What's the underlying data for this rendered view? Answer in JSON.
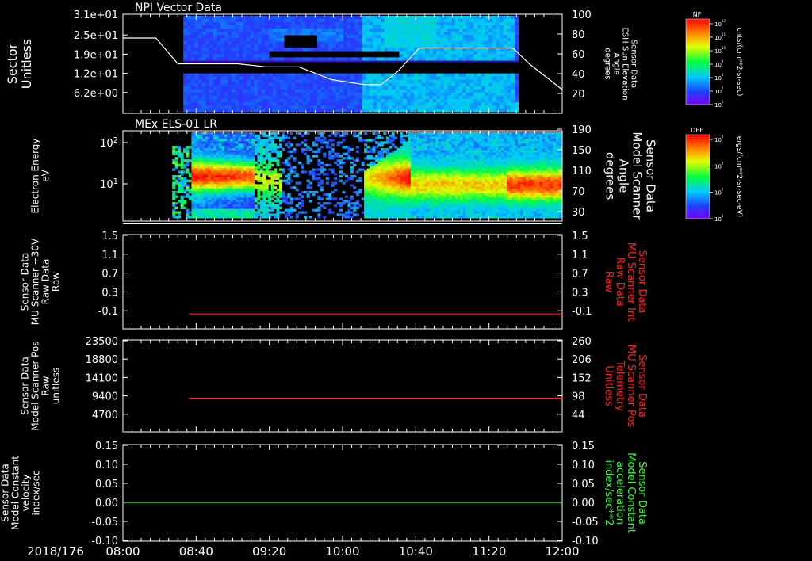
{
  "date_label": "2018/176",
  "time_ticks": [
    "08:00",
    "08:40",
    "09:20",
    "10:00",
    "10:40",
    "11:20",
    "12:00"
  ],
  "colors": {
    "white": "#ffffff",
    "red": "#ff2020",
    "green": "#33ff33",
    "background": "#000000"
  },
  "colorbars": [
    {
      "title": "NF",
      "unit": "cnts/(cm**2-sr-sec)",
      "ticks": [
        "10^12",
        "10^11",
        "10^10",
        "10^9",
        "10^8",
        "10^7",
        "10^6"
      ]
    },
    {
      "title": "DEF",
      "unit": "ergs/(cm**2-sr-sec-eV)",
      "ticks": [
        "10^4",
        "10^3",
        "10^2",
        "10^1"
      ]
    }
  ],
  "chart_data": [
    {
      "type": "heatmap",
      "title": "NPI Vector Data",
      "ylabel_lines": [
        "Sector",
        "Unitless"
      ],
      "yticks": [
        "3.1e+01",
        "2.5e+01",
        "1.9e+01",
        "1.2e+01",
        "6.2e+00"
      ],
      "right_label_lines": [
        "Sensor Data",
        "ESH Sun Elevation",
        "Angle",
        "degrees"
      ],
      "right_ticks": [
        "100",
        "80",
        "60",
        "40",
        "20"
      ],
      "right_ylim": [
        0,
        100
      ],
      "overlay_series": {
        "name": "ESH Sun Elevation Angle",
        "x_hours": [
          8.0,
          8.3,
          8.5,
          8.8,
          9.05,
          9.3,
          9.6,
          9.9,
          10.2,
          10.35,
          10.5,
          10.7,
          10.9,
          11.0,
          11.2,
          11.4,
          11.55,
          11.7,
          12.0
        ],
        "y": [
          76,
          76,
          50,
          50,
          50,
          47,
          47,
          34,
          29,
          29,
          42,
          66,
          66,
          66,
          66,
          66,
          66,
          50,
          24
        ]
      }
    },
    {
      "type": "heatmap",
      "title": "MEx ELS-01 LR",
      "ylabel_lines": [
        "Electron Energy",
        "eV"
      ],
      "yticks": [
        "10^2",
        "10^1"
      ],
      "right_label_lines": [
        "Sensor Data",
        "Model Scanner",
        "Angle",
        "degrees"
      ],
      "right_ticks": [
        "190",
        "150",
        "110",
        "70",
        "30"
      ],
      "right_ylim": [
        10,
        190
      ],
      "overlay_series": {
        "name": "Model Scanner Angle",
        "x_hours": [
          8.0,
          12.0
        ],
        "y": [
          11,
          11
        ]
      }
    },
    {
      "type": "line",
      "ylabel_lines": [
        "Sensor Data",
        "MU Scanner +30V",
        "Raw Data",
        "Raw"
      ],
      "yticks": [
        "1.5",
        "1.1",
        "0.7",
        "0.3",
        "-0.1"
      ],
      "right_label_lines": [
        "Sensor Data",
        "MU Scanner Int",
        "Raw Data",
        "Raw"
      ],
      "right_ticks": [
        "1.5",
        "1.1",
        "0.7",
        "0.3",
        "-0.1"
      ],
      "ylim": [
        -0.3,
        1.5
      ],
      "series": [
        {
          "name": "MU Scanner Int Raw Data",
          "x_hours": [
            8.6,
            12.0
          ],
          "y": [
            0.0,
            0.0
          ]
        }
      ]
    },
    {
      "type": "line",
      "ylabel_lines": [
        "Sensor Data",
        "Model Scanner Pos",
        "Raw",
        "unitless"
      ],
      "yticks": [
        "23500",
        "18800",
        "14100",
        "9400",
        "4700"
      ],
      "right_label_lines": [
        "Sensor Data",
        "MU Scanner Pos",
        "Telemetry",
        "Unitless"
      ],
      "right_ticks": [
        "260",
        "206",
        "152",
        "98",
        "44"
      ],
      "ylim": [
        0,
        23500
      ],
      "series": [
        {
          "name": "MU Scanner Pos Telemetry",
          "x_hours": [
            8.6,
            12.0
          ],
          "y": [
            9000,
            9000
          ]
        }
      ]
    },
    {
      "type": "line",
      "ylabel_lines": [
        "Sensor Data",
        "Model Constant",
        "velocity",
        "index/sec"
      ],
      "yticks": [
        "0.15",
        "0.10",
        "0.05",
        "0.00",
        "-0.05",
        "-0.10"
      ],
      "right_label_lines": [
        "Sensor Data",
        "Model Constant",
        "acceleration",
        "index/sec**2"
      ],
      "right_ticks": [
        "0.15",
        "0.10",
        "0.05",
        "0.00",
        "-0.05",
        "-0.10"
      ],
      "ylim": [
        -0.1,
        0.15
      ],
      "series": [
        {
          "name": "Model Constant acceleration",
          "x_hours": [
            8.0,
            12.0
          ],
          "y": [
            0.0,
            0.0
          ]
        }
      ]
    }
  ]
}
